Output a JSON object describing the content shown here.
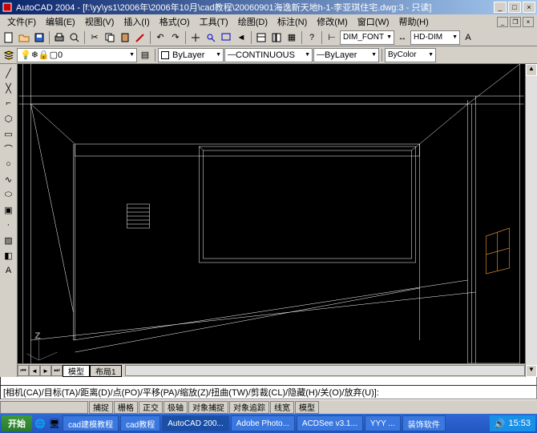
{
  "title": "AutoCAD 2004 - [f:\\yy\\ys1\\2006年\\2006年10月\\cad教程\\20060901海逸新天地h-1-李亚琪住宅.dwg:3 - 只读]",
  "menu": [
    "文件(F)",
    "编辑(E)",
    "视图(V)",
    "插入(I)",
    "格式(O)",
    "工具(T)",
    "绘图(D)",
    "标注(N)",
    "修改(M)",
    "窗口(W)",
    "帮助(H)"
  ],
  "toolbar2": {
    "layer": "0",
    "linetype": "CONTINUOUS",
    "lineweight": "ByLayer",
    "dimstyle": "DIM_FONT",
    "textstyle": "HD-DIM",
    "color": "ByColor",
    "bylayer": "ByLayer"
  },
  "ucs_label": "Z",
  "tabs": [
    "模型",
    "布局1"
  ],
  "cmd": "[相机(CA)/目标(TA)/距离(D)/点(PO)/平移(PA)/缩放(Z)/扭曲(TW)/剪裁(CL)/隐藏(H)/关(O)/放弃(U)]:",
  "status": [
    "捕捉",
    "栅格",
    "正交",
    "极轴",
    "对象捕捉",
    "对象追踪",
    "线宽",
    "模型"
  ],
  "start": "开始",
  "tasks": [
    "cad建模教程",
    "cad教程",
    "AutoCAD 200...",
    "Adobe Photo...",
    "ACDSee v3.1...",
    "YYY ...",
    "装饰软件"
  ],
  "clock": "15:53"
}
